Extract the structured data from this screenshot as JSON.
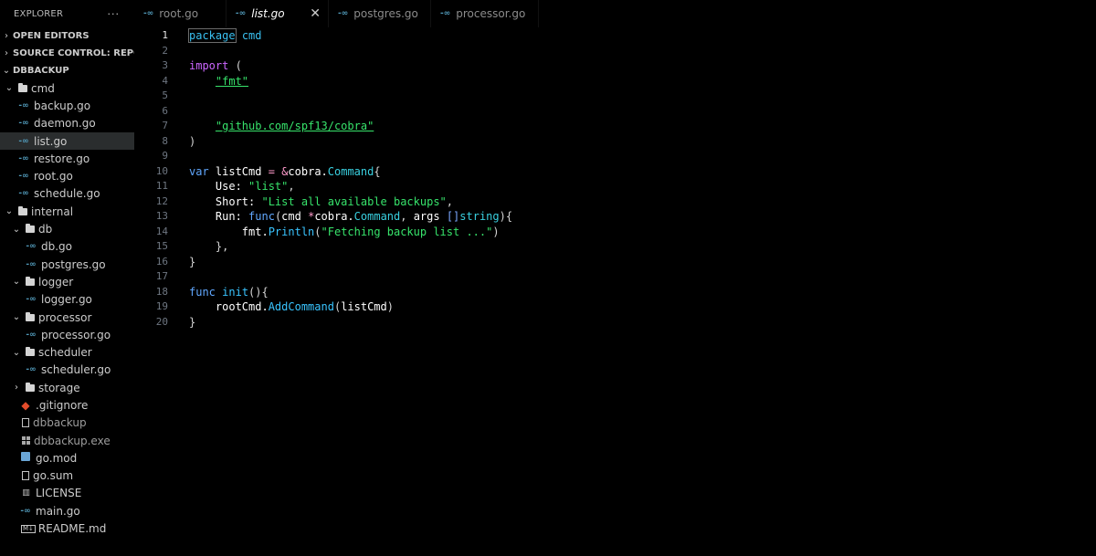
{
  "sidebar": {
    "title": "EXPLORER",
    "more": "···",
    "sections": {
      "open_editors": "OPEN EDITORS",
      "source_control": "SOURCE CONTROL: REPOS...",
      "project": "DBBACKUP"
    },
    "tree": [
      {
        "label": "cmd",
        "type": "folder",
        "expanded": true,
        "depth": 0
      },
      {
        "label": "backup.go",
        "type": "go",
        "depth": 1
      },
      {
        "label": "daemon.go",
        "type": "go",
        "depth": 1
      },
      {
        "label": "list.go",
        "type": "go",
        "depth": 1,
        "active": true
      },
      {
        "label": "restore.go",
        "type": "go",
        "depth": 1
      },
      {
        "label": "root.go",
        "type": "go",
        "depth": 1
      },
      {
        "label": "schedule.go",
        "type": "go",
        "depth": 1
      },
      {
        "label": "internal",
        "type": "folder",
        "expanded": true,
        "depth": 0
      },
      {
        "label": "db",
        "type": "folder",
        "expanded": true,
        "depth": 1
      },
      {
        "label": "db.go",
        "type": "go",
        "depth": 2
      },
      {
        "label": "postgres.go",
        "type": "go",
        "depth": 2
      },
      {
        "label": "logger",
        "type": "folder",
        "expanded": true,
        "depth": 1
      },
      {
        "label": "logger.go",
        "type": "go",
        "depth": 2
      },
      {
        "label": "processor",
        "type": "folder",
        "expanded": true,
        "depth": 1
      },
      {
        "label": "processor.go",
        "type": "go",
        "depth": 2
      },
      {
        "label": "scheduler",
        "type": "folder",
        "expanded": true,
        "depth": 1
      },
      {
        "label": "scheduler.go",
        "type": "go",
        "depth": 2
      },
      {
        "label": "storage",
        "type": "folder",
        "expanded": false,
        "depth": 1
      },
      {
        "label": ".gitignore",
        "type": "git",
        "depth": 0
      },
      {
        "label": "dbbackup",
        "type": "file",
        "depth": 0,
        "dim": true
      },
      {
        "label": "dbbackup.exe",
        "type": "exe",
        "depth": 0,
        "dim": true
      },
      {
        "label": "go.mod",
        "type": "mod",
        "depth": 0
      },
      {
        "label": "go.sum",
        "type": "file",
        "depth": 0
      },
      {
        "label": "LICENSE",
        "type": "license",
        "depth": 0
      },
      {
        "label": "main.go",
        "type": "go",
        "depth": 0
      },
      {
        "label": "README.md",
        "type": "md",
        "depth": 0
      }
    ]
  },
  "tabs": [
    {
      "label": "root.go",
      "active": false
    },
    {
      "label": "list.go",
      "active": true,
      "close": "✕"
    },
    {
      "label": "postgres.go",
      "active": false
    },
    {
      "label": "processor.go",
      "active": false
    }
  ],
  "editor": {
    "current_line": 1,
    "lines": [
      {
        "n": "1",
        "tokens": [
          [
            "pkgkw cursorbox",
            "package"
          ],
          [
            "",
            " "
          ],
          [
            "pkgkw",
            "cmd"
          ]
        ]
      },
      {
        "n": "2",
        "tokens": []
      },
      {
        "n": "3",
        "tokens": [
          [
            "kw",
            "import"
          ],
          [
            "punc",
            " ("
          ]
        ]
      },
      {
        "n": "4",
        "tokens": [
          [
            "",
            "    "
          ],
          [
            "strl",
            "\"fmt\""
          ]
        ]
      },
      {
        "n": "5",
        "tokens": []
      },
      {
        "n": "6",
        "tokens": []
      },
      {
        "n": "7",
        "tokens": [
          [
            "",
            "    "
          ],
          [
            "strl",
            "\"github.com/spf13/cobra\""
          ]
        ]
      },
      {
        "n": "8",
        "tokens": [
          [
            "punc",
            ")"
          ]
        ]
      },
      {
        "n": "9",
        "tokens": []
      },
      {
        "n": "10",
        "tokens": [
          [
            "kw2",
            "var"
          ],
          [
            "",
            " listCmd "
          ],
          [
            "op",
            "="
          ],
          [
            "",
            " "
          ],
          [
            "op",
            "&"
          ],
          [
            "",
            "cobra."
          ],
          [
            "typ",
            "Command"
          ],
          [
            "punc",
            "{"
          ]
        ]
      },
      {
        "n": "11",
        "tokens": [
          [
            "",
            "    Use: "
          ],
          [
            "str",
            "\"list\""
          ],
          [
            "punc",
            ","
          ]
        ]
      },
      {
        "n": "12",
        "tokens": [
          [
            "",
            "    Short: "
          ],
          [
            "str",
            "\"List all available backups\""
          ],
          [
            "punc",
            ","
          ]
        ]
      },
      {
        "n": "13",
        "tokens": [
          [
            "",
            "    Run: "
          ],
          [
            "kw2",
            "func"
          ],
          [
            "punc",
            "("
          ],
          [
            "",
            "cmd "
          ],
          [
            "op",
            "*"
          ],
          [
            "",
            "cobra."
          ],
          [
            "typ",
            "Command"
          ],
          [
            "punc",
            ", "
          ],
          [
            "",
            "args "
          ],
          [
            "bro",
            "[]"
          ],
          [
            "typ",
            "string"
          ],
          [
            "punc",
            ")"
          ],
          [
            "punc",
            "{"
          ]
        ]
      },
      {
        "n": "14",
        "tokens": [
          [
            "",
            "        fmt."
          ],
          [
            "fn",
            "Println"
          ],
          [
            "punc",
            "("
          ],
          [
            "str",
            "\"Fetching backup list ...\""
          ],
          [
            "punc",
            ")"
          ]
        ]
      },
      {
        "n": "15",
        "tokens": [
          [
            "",
            "    "
          ],
          [
            "punc",
            "},"
          ]
        ]
      },
      {
        "n": "16",
        "tokens": [
          [
            "punc",
            "}"
          ]
        ]
      },
      {
        "n": "17",
        "tokens": []
      },
      {
        "n": "18",
        "tokens": [
          [
            "kw2",
            "func"
          ],
          [
            "",
            " "
          ],
          [
            "fn",
            "init"
          ],
          [
            "punc",
            "(){"
          ]
        ]
      },
      {
        "n": "19",
        "tokens": [
          [
            "",
            "    rootCmd."
          ],
          [
            "fn",
            "AddCommand"
          ],
          [
            "punc",
            "("
          ],
          [
            "",
            "listCmd"
          ],
          [
            "punc",
            ")"
          ]
        ]
      },
      {
        "n": "20",
        "tokens": [
          [
            "punc",
            "}"
          ]
        ]
      }
    ]
  },
  "colors": {
    "background": "#000000",
    "go_icon": "#519aba",
    "git_icon": "#e44c2b",
    "keyword": "#cc66ff",
    "string": "#37e36b",
    "type": "#39d0e0"
  }
}
